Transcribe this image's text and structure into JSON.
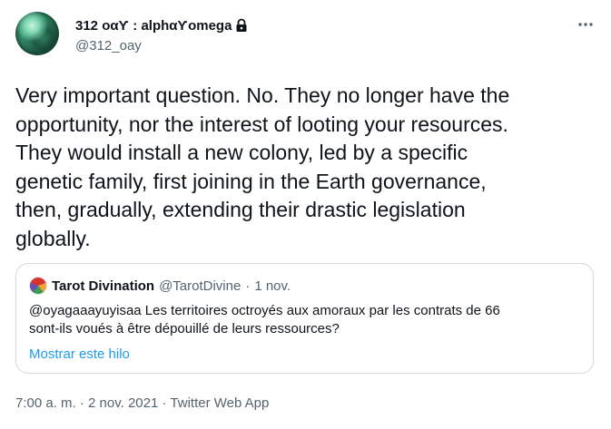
{
  "author": {
    "display_name": "312 οαƳ : alphαƳomega",
    "handle": "@312_oay",
    "protected_icon": "lock-icon"
  },
  "more_icon": "more-horizontal-icon",
  "tweet": {
    "text": "Very important question. No. They no longer have the\nopportunity, nor the interest of looting your resources.\nThey would install a new colony, led by a specific\ngenetic family, first joining in the Earth governance,\nthen, gradually, extending their drastic legislation\nglobally."
  },
  "quote": {
    "display_name": "Tarot Divination",
    "handle": "@TarotDivine",
    "separator": "·",
    "date": "1 nov.",
    "text": "@oyagaaayuyisaa Les territoires octroyés aux amoraux par les contrats de 66\nsont-ils voués à être dépouillé de leurs ressources?",
    "show_thread": "Mostrar este hilo"
  },
  "meta": {
    "time": "7:00 a. m.",
    "separator_1": "·",
    "date": "2 nov. 2021",
    "separator_2": "·",
    "source": "Twitter Web App"
  },
  "colors": {
    "text": "#0f1419",
    "secondary": "#536471",
    "link": "#1d9bf0",
    "border": "#cfd9de"
  }
}
